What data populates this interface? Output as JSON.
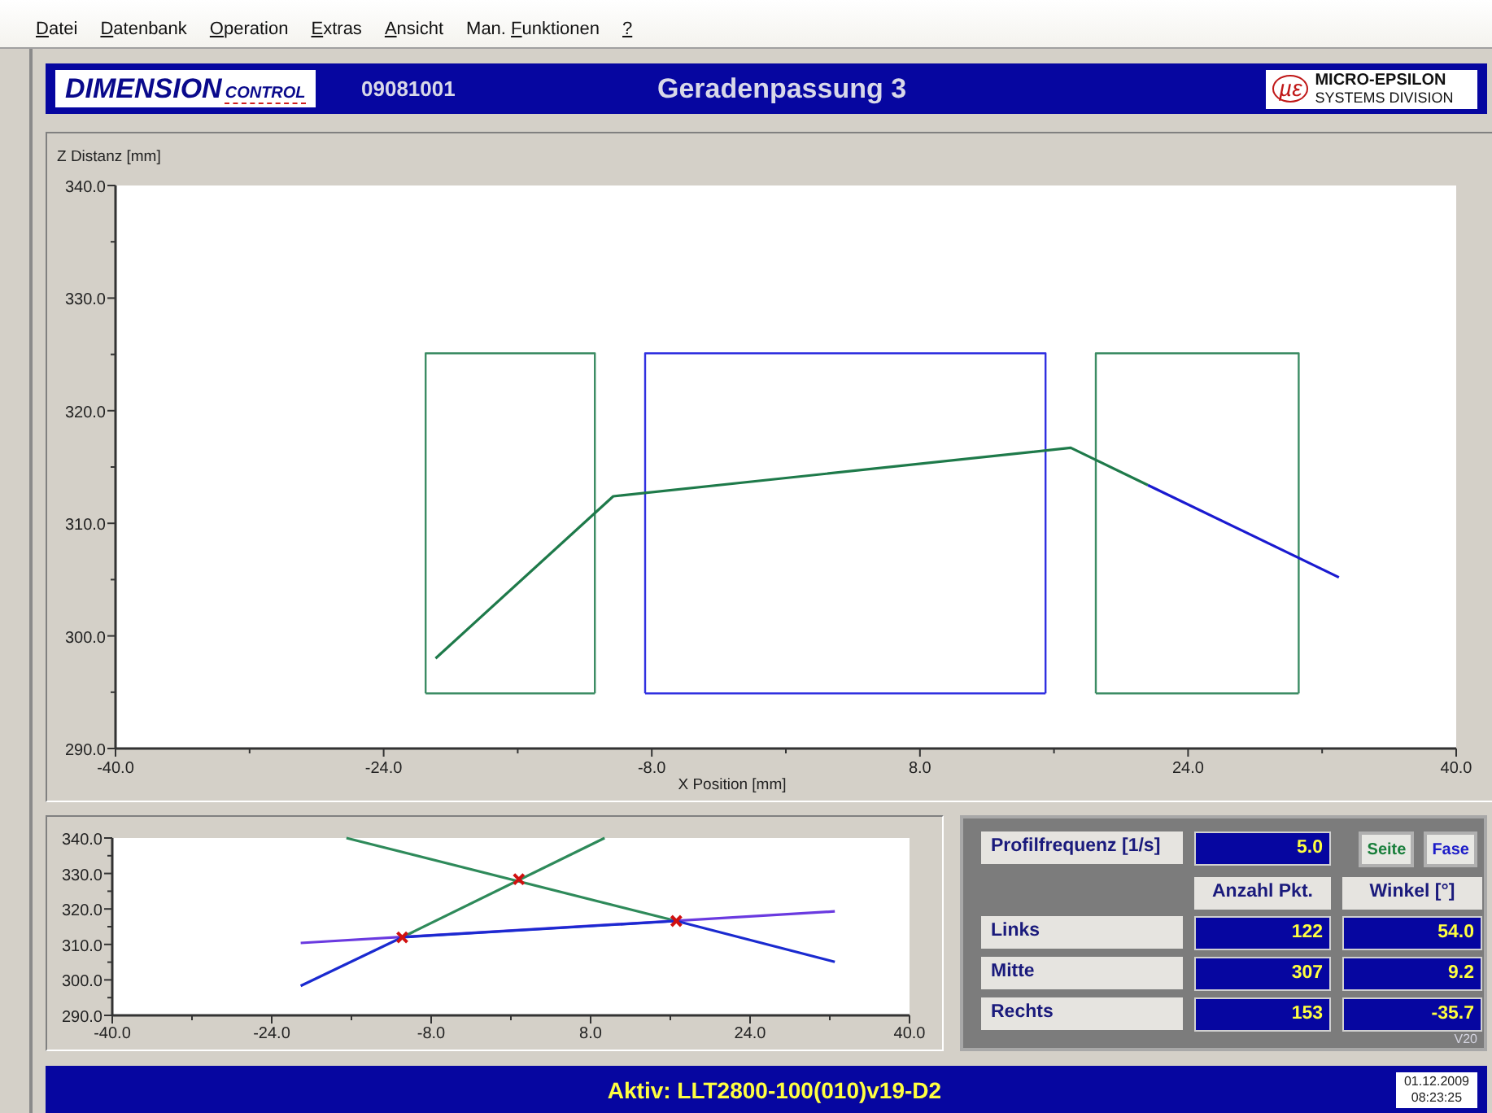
{
  "menu": [
    {
      "key": "D",
      "rest": "atei"
    },
    {
      "key": "D",
      "rest": "atenbank"
    },
    {
      "key": "O",
      "rest": "peration"
    },
    {
      "key": "E",
      "rest": "xtras"
    },
    {
      "key": "A",
      "rest": "nsicht"
    },
    {
      "before": "Man. ",
      "key": "F",
      "rest": "unktionen"
    },
    {
      "key": "?"
    }
  ],
  "header": {
    "logo_main": "DIMENSION",
    "logo_sub": "CONTROL",
    "code": "09081001",
    "title": "Geradenpassung 3",
    "brand_mark": "µε",
    "brand_name": "MICRO-EPSILON",
    "brand_division": "SYSTEMS DIVISION"
  },
  "main_chart": {
    "chart_data": {
      "type": "line",
      "xlabel": "X Position [mm]",
      "ylabel": "Z Distanz [mm]",
      "xlim": [
        -40,
        40
      ],
      "ylim": [
        290,
        340
      ],
      "xticks": [
        {
          "value": -40,
          "label": "-40.0"
        },
        {
          "value": -24,
          "label": "-24.0"
        },
        {
          "value": -8,
          "label": "-8.0"
        },
        {
          "value": 8,
          "label": "8.0"
        },
        {
          "value": 24,
          "label": "24.0"
        },
        {
          "value": 40,
          "label": "40.0"
        }
      ],
      "yticks": [
        {
          "value": 290,
          "label": "290.0"
        },
        {
          "value": 300,
          "label": "300.0"
        },
        {
          "value": 310,
          "label": "310.0"
        },
        {
          "value": 320,
          "label": "320.0"
        },
        {
          "value": 330,
          "label": "330.0"
        },
        {
          "value": 340,
          "label": "340.0"
        }
      ],
      "series": [
        {
          "type": "line",
          "color": "#3c8c64",
          "x": [
            -21.5,
            -21.5,
            -11.4,
            -11.4
          ],
          "values": [
            294.9,
            325.1,
            325.1,
            294.9
          ]
        },
        {
          "type": "line",
          "color": "#3c8c64",
          "x": [
            -21.5,
            -11.4
          ],
          "values": [
            294.9,
            294.9
          ]
        },
        {
          "type": "line",
          "color": "#3030e0",
          "x": [
            -8.4,
            -8.4,
            15.5,
            15.5
          ],
          "values": [
            294.9,
            325.1,
            325.1,
            294.9
          ]
        },
        {
          "type": "line",
          "color": "#3030e0",
          "x": [
            -8.4,
            15.5
          ],
          "values": [
            294.9,
            294.9
          ]
        },
        {
          "type": "line",
          "color": "#3c8c64",
          "x": [
            18.5,
            18.5,
            30.6,
            30.6
          ],
          "values": [
            294.9,
            325.1,
            325.1,
            294.9
          ]
        },
        {
          "type": "line",
          "color": "#3c8c64",
          "x": [
            18.5,
            30.6
          ],
          "values": [
            294.9,
            294.9
          ]
        },
        {
          "type": "line",
          "color": "#1e7a4a",
          "x": [
            -20.9,
            -10.3,
            17.0,
            21.6
          ],
          "values": [
            298.0,
            312.4,
            316.7,
            313.4
          ]
        },
        {
          "type": "line",
          "color": "#1a1ad0",
          "x": [
            21.6,
            33.0
          ],
          "values": [
            313.4,
            305.2
          ]
        }
      ]
    }
  },
  "fit_chart": {
    "chart_data": {
      "type": "line",
      "xlim": [
        -40,
        40
      ],
      "ylim": [
        290,
        340
      ],
      "xticks": [
        {
          "value": -40,
          "label": "-40.0"
        },
        {
          "value": -24,
          "label": "-24.0"
        },
        {
          "value": -8,
          "label": "-8.0"
        },
        {
          "value": 8,
          "label": "8.0"
        },
        {
          "value": 24,
          "label": "24.0"
        },
        {
          "value": 40,
          "label": "40.0"
        }
      ],
      "yticks": [
        {
          "value": 290,
          "label": "290.0"
        },
        {
          "value": 300,
          "label": "300.0"
        },
        {
          "value": 310,
          "label": "310.0"
        },
        {
          "value": 320,
          "label": "320.0"
        },
        {
          "value": 330,
          "label": "330.0"
        },
        {
          "value": 340,
          "label": "340.0"
        }
      ],
      "series": [
        {
          "type": "line",
          "color": "#2e8a5a",
          "x": [
            -16.5,
            16.6
          ],
          "values": [
            340,
            316.6
          ]
        },
        {
          "type": "line",
          "color": "#2e8a5a",
          "x": [
            -10.9,
            9.4
          ],
          "values": [
            312.0,
            340
          ]
        },
        {
          "type": "line",
          "color": "#6a3ae0",
          "x": [
            -21.1,
            32.5
          ],
          "values": [
            310.4,
            319.3
          ]
        },
        {
          "type": "line",
          "color": "#1a2ad0",
          "x": [
            -21.1,
            -10.9,
            16.6,
            32.5
          ],
          "values": [
            298.3,
            312.0,
            316.6,
            305.1
          ]
        },
        {
          "type": "scatter",
          "color": "#d01010",
          "x": [
            -10.9,
            0.8,
            16.6
          ],
          "values": [
            312.0,
            328.4,
            316.6
          ]
        }
      ]
    }
  },
  "results": {
    "frequency_label": "Profilfrequenz [1/s]",
    "frequency_value": "5.0",
    "buttons": [
      {
        "label": "Seite",
        "color": "#1a7f3c"
      },
      {
        "label": "Fase",
        "color": "#1c1cc8"
      }
    ],
    "columns": [
      "Anzahl Pkt.",
      "Winkel [°]"
    ],
    "rows": [
      {
        "label": "Links",
        "points": "122",
        "angle": "54.0"
      },
      {
        "label": "Mitte",
        "points": "307",
        "angle": "9.2"
      },
      {
        "label": "Rechts",
        "points": "153",
        "angle": "-35.7"
      }
    ],
    "version": "V20"
  },
  "status": {
    "active": "Aktiv: LLT2800-100(010)v19-D2",
    "date": "01.12.2009",
    "time": "08:23:25"
  }
}
